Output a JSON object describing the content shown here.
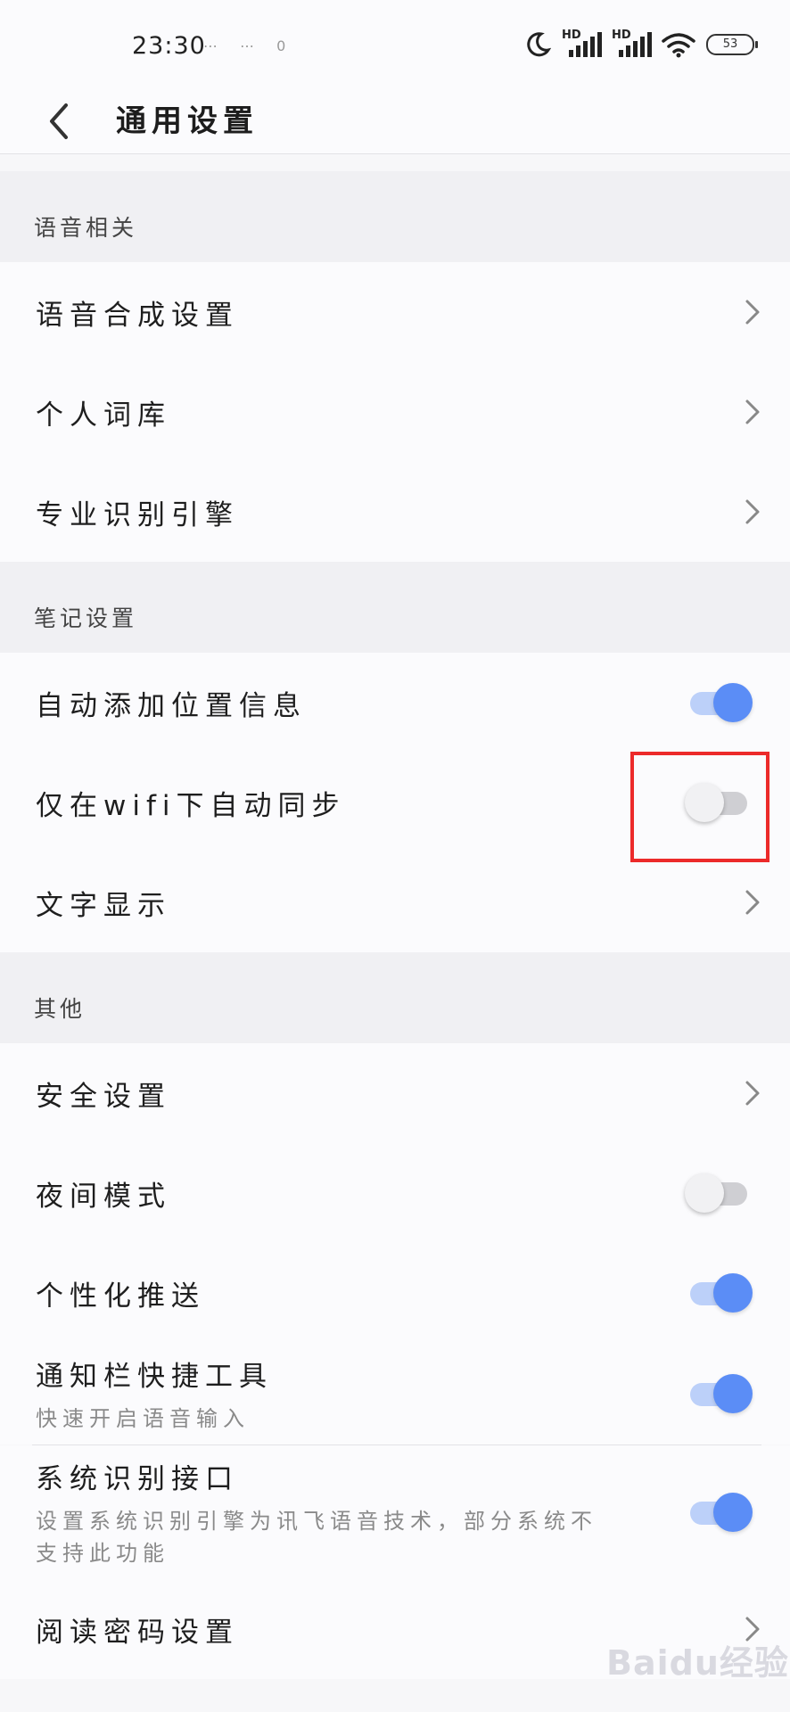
{
  "status_bar": {
    "time": "23:30",
    "misc": "⋯ ⋯ 0",
    "signal_label_1": "HD",
    "signal_label_2": "HD",
    "battery": "53",
    "icons": [
      "moon-icon",
      "signal-icon",
      "signal-icon",
      "wifi-icon",
      "battery-icon"
    ]
  },
  "header": {
    "title": "通用设置",
    "back_icon": "chevron-left-icon"
  },
  "sections": {
    "voice": {
      "title": "语音相关",
      "items": [
        {
          "label": "语音合成设置"
        },
        {
          "label": "个人词库"
        },
        {
          "label": "专业识别引擎"
        }
      ]
    },
    "notes": {
      "title": "笔记设置",
      "items": [
        {
          "label": "自动添加位置信息",
          "toggle": "on"
        },
        {
          "label": "仅在wifi下自动同步",
          "toggle": "off"
        },
        {
          "label": "文字显示"
        }
      ]
    },
    "other": {
      "title": "其他",
      "items": [
        {
          "label": "安全设置"
        },
        {
          "label": "夜间模式",
          "toggle": "off"
        },
        {
          "label": "个性化推送",
          "toggle": "on"
        },
        {
          "label": "通知栏快捷工具",
          "sub": "快速开启语音输入",
          "toggle": "on"
        },
        {
          "label": "系统识别接口",
          "sub": "设置系统识别引擎为讯飞语音技术，部分系统不支持此功能",
          "toggle": "on"
        },
        {
          "label": "阅读密码设置"
        }
      ]
    }
  },
  "watermark": "Baidu经验",
  "colors": {
    "toggle_on": "#5b8df6",
    "toggle_on_track": "#bcd0f9",
    "highlight": "#ec2a2a",
    "section_bg": "#f0f0f3"
  }
}
